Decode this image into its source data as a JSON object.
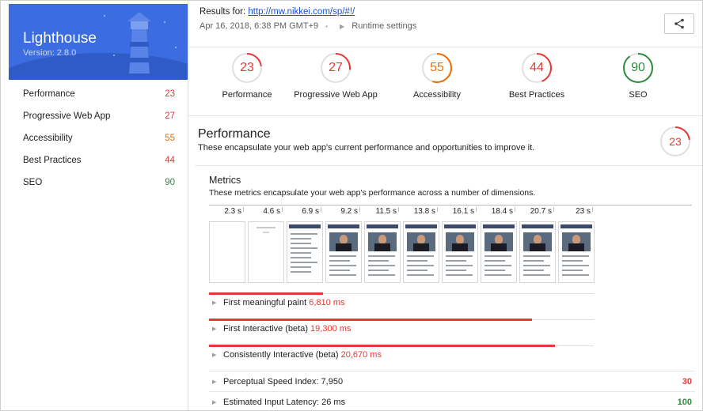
{
  "app": {
    "title": "Lighthouse",
    "version": "Version: 2.8.0"
  },
  "colors": {
    "red": "#e53935",
    "orange": "#ef6c00",
    "green": "#2e8b3d",
    "brand": "#3b6de0",
    "link": "#1a4fd8"
  },
  "sidebar": {
    "items": [
      {
        "label": "Performance",
        "score": "23",
        "color": "#e53935"
      },
      {
        "label": "Progressive Web App",
        "score": "27",
        "color": "#e53935"
      },
      {
        "label": "Accessibility",
        "score": "55",
        "color": "#ef6c00"
      },
      {
        "label": "Best Practices",
        "score": "44",
        "color": "#e53935"
      },
      {
        "label": "SEO",
        "score": "90",
        "color": "#2e8b3d"
      }
    ]
  },
  "header": {
    "results_prefix": "Results for: ",
    "url": "http://mw.nikkei.com/sp/#!/",
    "date": "Apr 16, 2018, 6:38 PM GMT+9",
    "bullet": "•",
    "runtime_settings": "Runtime settings",
    "share_icon": "share-icon"
  },
  "gauges": [
    {
      "label": "Performance",
      "score": 23,
      "color": "#e53935"
    },
    {
      "label": "Progressive Web App",
      "score": 27,
      "color": "#e53935"
    },
    {
      "label": "Accessibility",
      "score": 55,
      "color": "#ef6c00"
    },
    {
      "label": "Best Practices",
      "score": 44,
      "color": "#e53935"
    },
    {
      "label": "SEO",
      "score": 90,
      "color": "#2e8b3d"
    }
  ],
  "section": {
    "title": "Performance",
    "description": "These encapsulate your web app's current performance and opportunities to improve it.",
    "score": 23
  },
  "metrics": {
    "title": "Metrics",
    "description": "These metrics encapsulate your web app's performance across a number of dimensions.",
    "timeline_ticks": [
      "2.3 s",
      "4.6 s",
      "6.9 s",
      "9.2 s",
      "11.5 s",
      "13.8 s",
      "16.1 s",
      "18.4 s",
      "20.7 s",
      "23 s"
    ],
    "filmstrip": [
      "blank",
      "loading",
      "text",
      "full",
      "full",
      "full",
      "full",
      "full",
      "full",
      "full"
    ],
    "timed": [
      {
        "label": "First meaningful paint",
        "value": "6,810 ms",
        "fraction": 0.296
      },
      {
        "label": "First Interactive (beta)",
        "value": "19,300 ms",
        "fraction": 0.839
      },
      {
        "label": "Consistently Interactive (beta)",
        "value": "20,670 ms",
        "fraction": 0.899
      }
    ],
    "scored": [
      {
        "label": "Perceptual Speed Index: 7,950",
        "score": "30",
        "color": "#e53935"
      },
      {
        "label": "Estimated Input Latency: 26 ms",
        "score": "100",
        "color": "#2e8b3d"
      }
    ]
  }
}
